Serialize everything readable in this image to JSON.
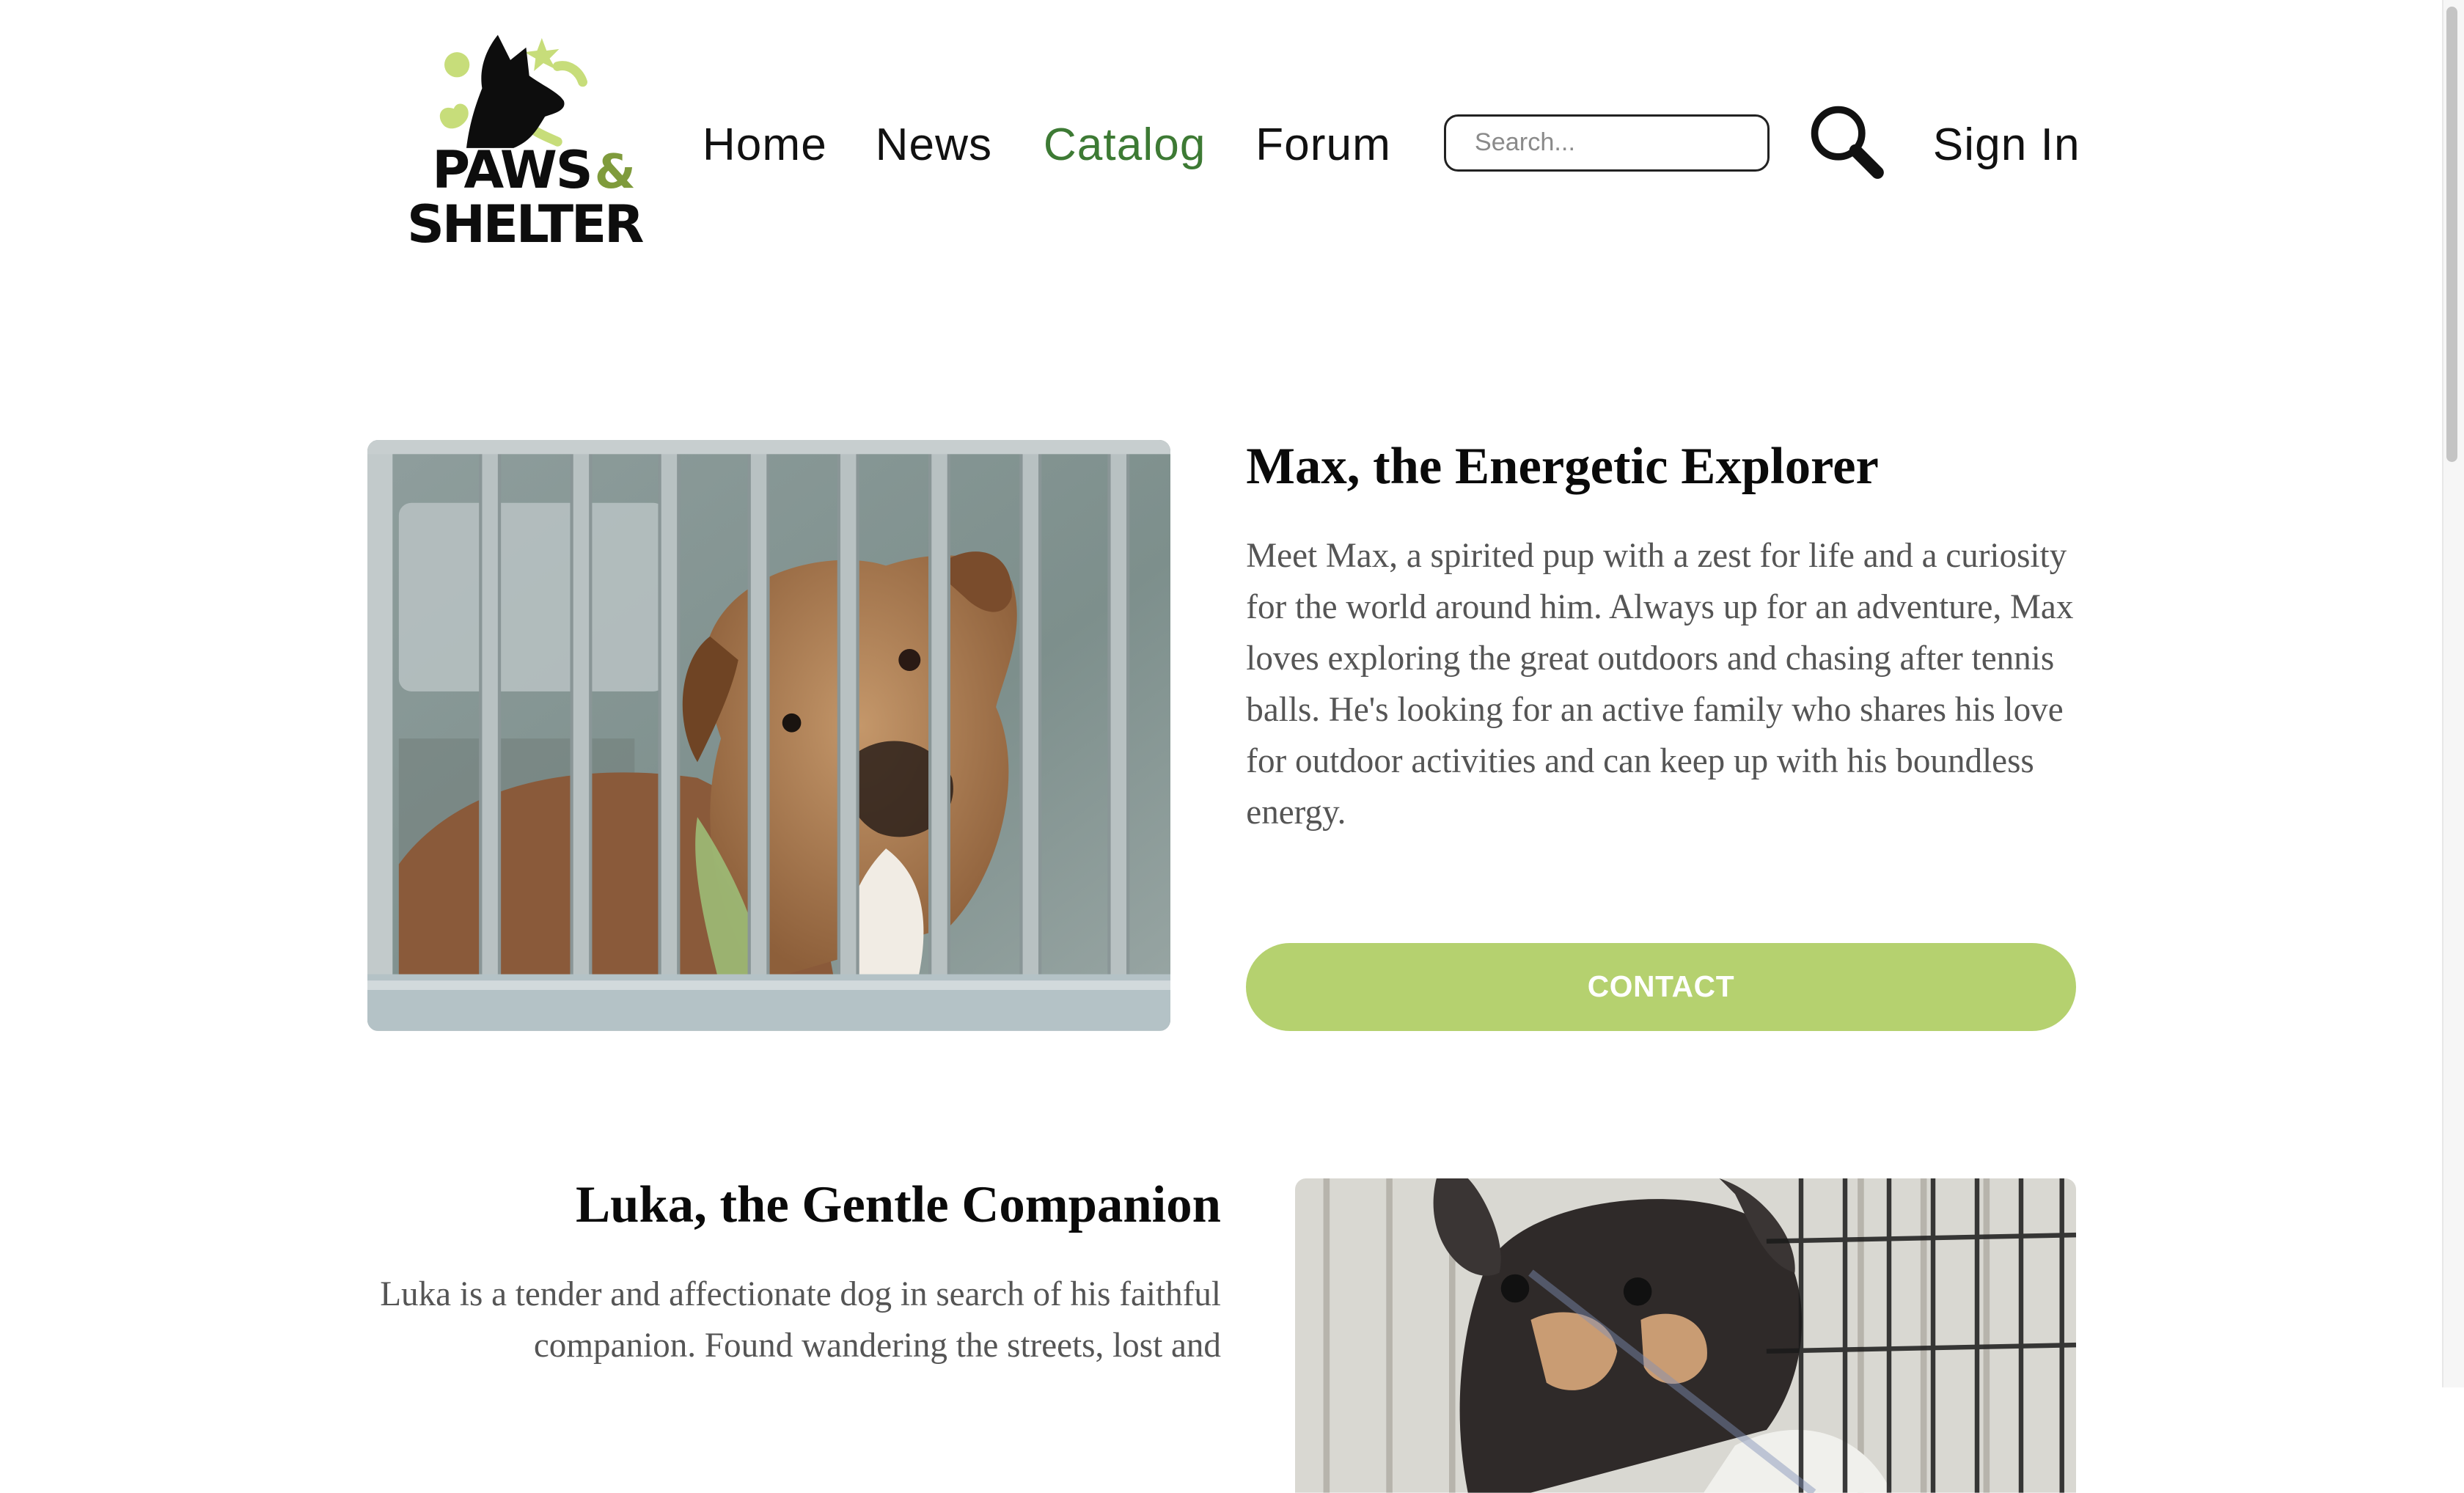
{
  "header": {
    "logo": {
      "line1": "PAWS",
      "amp": "&",
      "line2": "SHELTER"
    },
    "nav": [
      {
        "label": "Home",
        "active": false
      },
      {
        "label": "News",
        "active": false
      },
      {
        "label": "Catalog",
        "active": true
      },
      {
        "label": "Forum",
        "active": false
      }
    ],
    "search": {
      "placeholder": "Search...",
      "value": ""
    },
    "search_icon": "magnifier-icon",
    "sign_in_label": "Sign In"
  },
  "pets": [
    {
      "name": "Max, the Energetic Explorer",
      "description": "Meet Max, a spirited pup with a zest for life and a curiosity for the world around him. Always up for an adventure, Max loves exploring the great outdoors and chasing after tennis balls. He's looking for an active family who shares his love for outdoor activities and can keep up with his boundless energy.",
      "contact_label": "CONTACT"
    },
    {
      "name": "Luka, the Gentle Companion",
      "description": "Luka is a tender and affectionate dog in search of his faithful companion. Found wandering the streets, lost and"
    }
  ],
  "colors": {
    "accent": "#3d7a34",
    "button": "#b5d16f",
    "logo_lime": "#c7dd7a",
    "logo_olive": "#7f9b3c",
    "text_muted": "#555555"
  }
}
